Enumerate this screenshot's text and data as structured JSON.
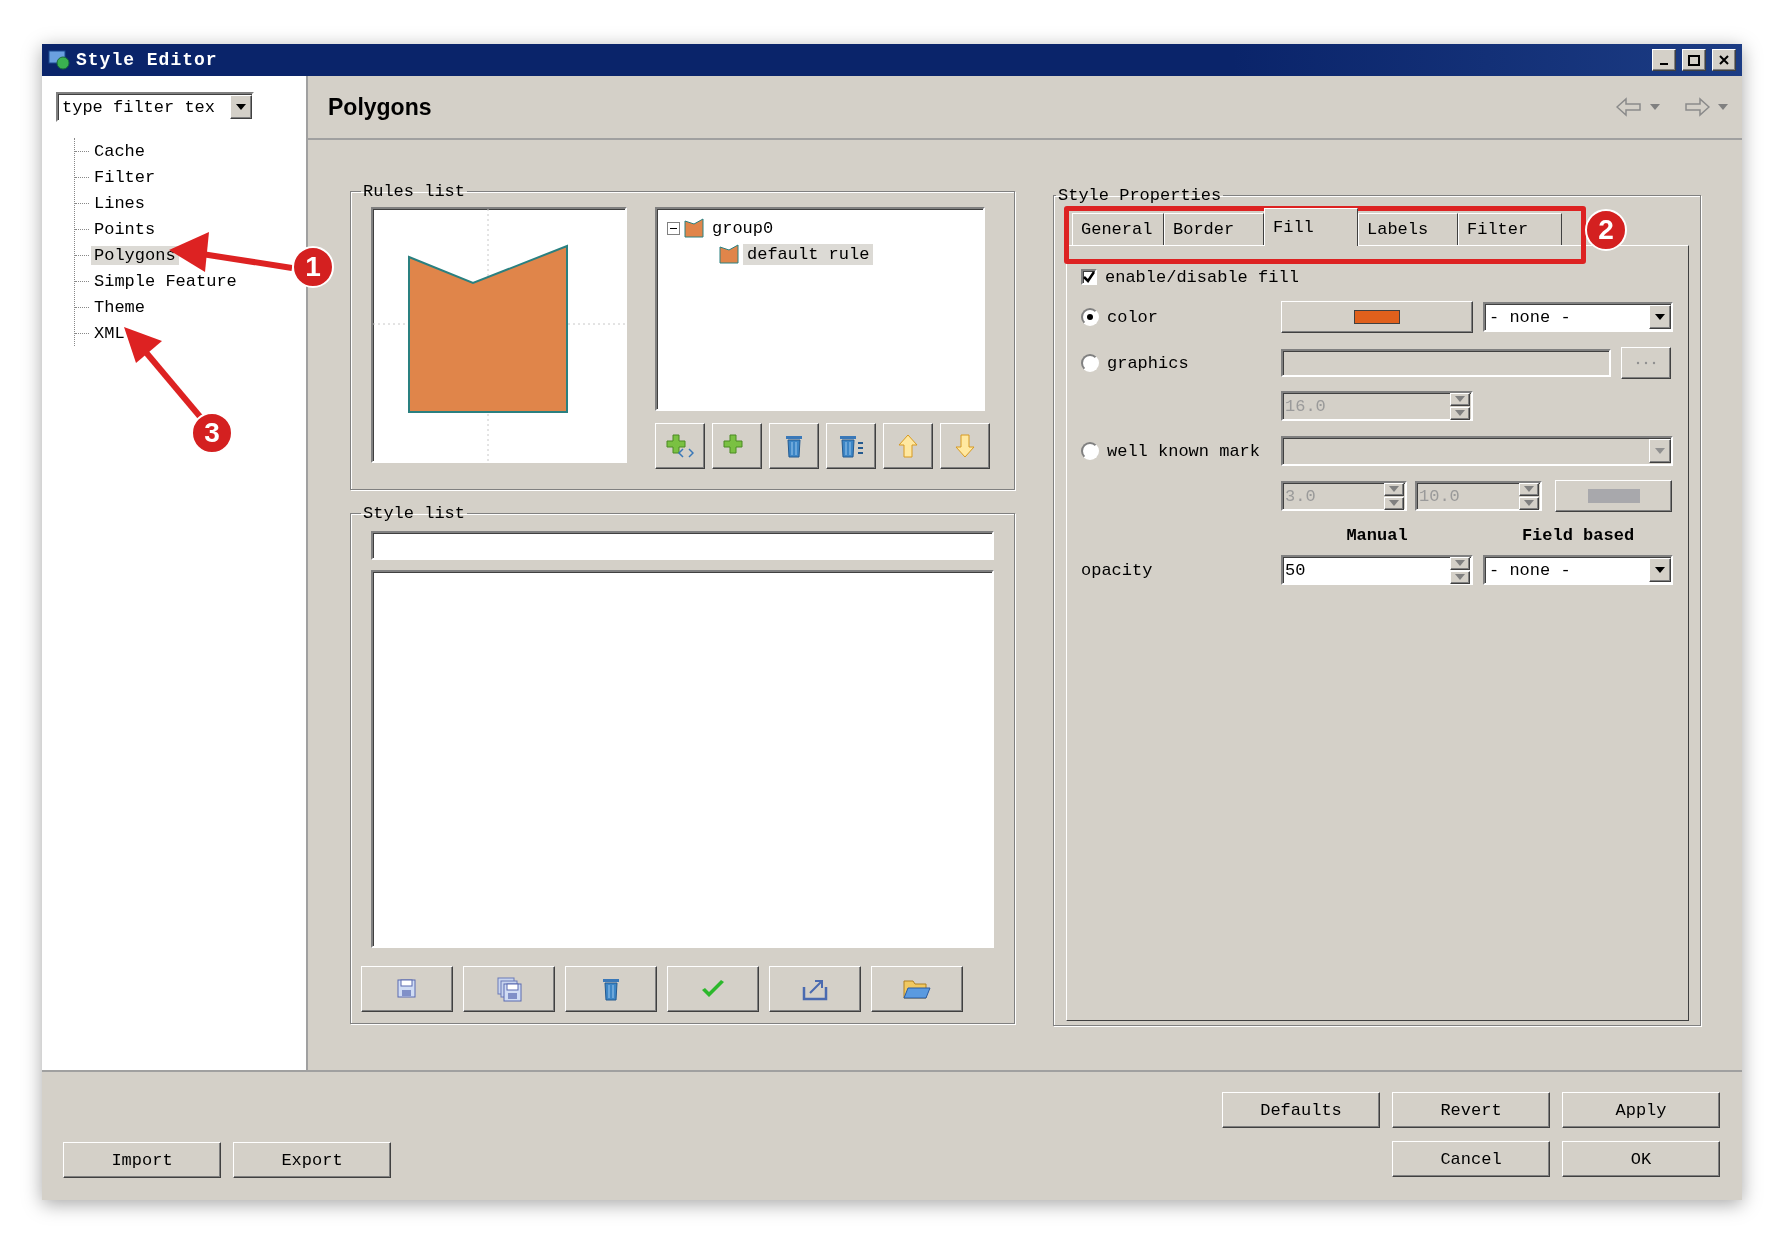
{
  "window": {
    "title": "Style Editor"
  },
  "sidebar": {
    "filter": {
      "placeholder": "type filter tex"
    },
    "items": [
      {
        "label": "Cache",
        "selected": false
      },
      {
        "label": "Filter",
        "selected": false
      },
      {
        "label": "Lines",
        "selected": false
      },
      {
        "label": "Points",
        "selected": false
      },
      {
        "label": "Polygons",
        "selected": true
      },
      {
        "label": "Simple Feature",
        "selected": false
      },
      {
        "label": "Theme",
        "selected": false
      },
      {
        "label": "XML",
        "selected": false
      }
    ]
  },
  "page": {
    "title": "Polygons"
  },
  "rules_list": {
    "title": "Rules list",
    "tree": [
      {
        "label": "group0",
        "expanded": true,
        "selected": false,
        "children": [
          {
            "label": "default rule",
            "selected": true
          }
        ]
      }
    ]
  },
  "style_list": {
    "title": "Style list"
  },
  "style_properties": {
    "title": "Style Properties",
    "tabs": [
      {
        "label": "General",
        "selected": false
      },
      {
        "label": "Border",
        "selected": false
      },
      {
        "label": "Fill",
        "selected": true
      },
      {
        "label": "Labels",
        "selected": false
      },
      {
        "label": "Filter",
        "selected": false
      }
    ],
    "enable_fill": {
      "label": "enable/disable fill",
      "checked": true
    },
    "color": {
      "label": "color",
      "selected": true,
      "field": "- none -"
    },
    "graphics": {
      "label": "graphics",
      "selected": false,
      "disabled": true,
      "size": "16.0"
    },
    "mark": {
      "label": "well known mark",
      "selected": false,
      "disabled": true,
      "size": "3.0",
      "rotation": "10.0"
    },
    "columns": [
      "Manual",
      "Field based"
    ],
    "opacity": {
      "label": "opacity",
      "value": "50",
      "field": "- none -"
    }
  },
  "buttons": {
    "right_top": [
      "Defaults",
      "Revert",
      "Apply"
    ],
    "right_bottom": [
      "Cancel",
      "OK"
    ],
    "left": [
      "Import",
      "Export"
    ]
  },
  "annotations": [
    {
      "number": "1"
    },
    {
      "number": "2"
    },
    {
      "number": "3"
    }
  ]
}
